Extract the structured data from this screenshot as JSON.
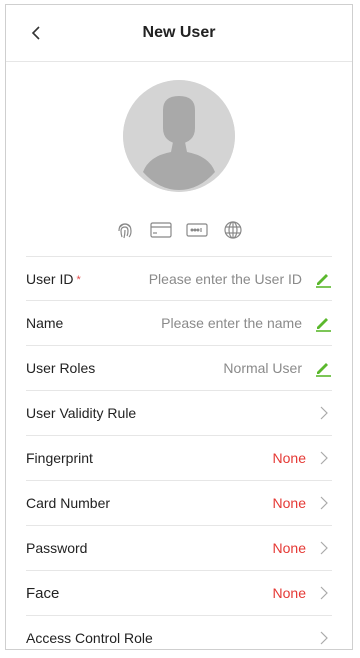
{
  "header": {
    "title": "New User"
  },
  "icons": [
    {
      "name": "fingerprint-icon"
    },
    {
      "name": "card-icon"
    },
    {
      "name": "password-icon"
    },
    {
      "name": "face-icon"
    }
  ],
  "fields": [
    {
      "label": "User ID",
      "required": "*",
      "value": "Please enter the User ID",
      "type": "edit"
    },
    {
      "label": "Name",
      "value": "Please enter the name",
      "type": "edit"
    },
    {
      "label": "User Roles",
      "value": "Normal User",
      "type": "edit"
    },
    {
      "label": "User Validity Rule",
      "value": "",
      "type": "chevron"
    },
    {
      "label": "Fingerprint",
      "value": "None",
      "type": "chevron"
    },
    {
      "label": "Card Number",
      "value": "None",
      "type": "chevron"
    },
    {
      "label": "Password",
      "value": "None",
      "type": "chevron"
    },
    {
      "label": "Face",
      "value": "None",
      "type": "chevron"
    },
    {
      "label": "Access Control Role",
      "value": "",
      "type": "chevron"
    }
  ],
  "colors": {
    "accent": "#5bb82d",
    "danger": "#e53935",
    "muted": "#8a8a8a"
  }
}
